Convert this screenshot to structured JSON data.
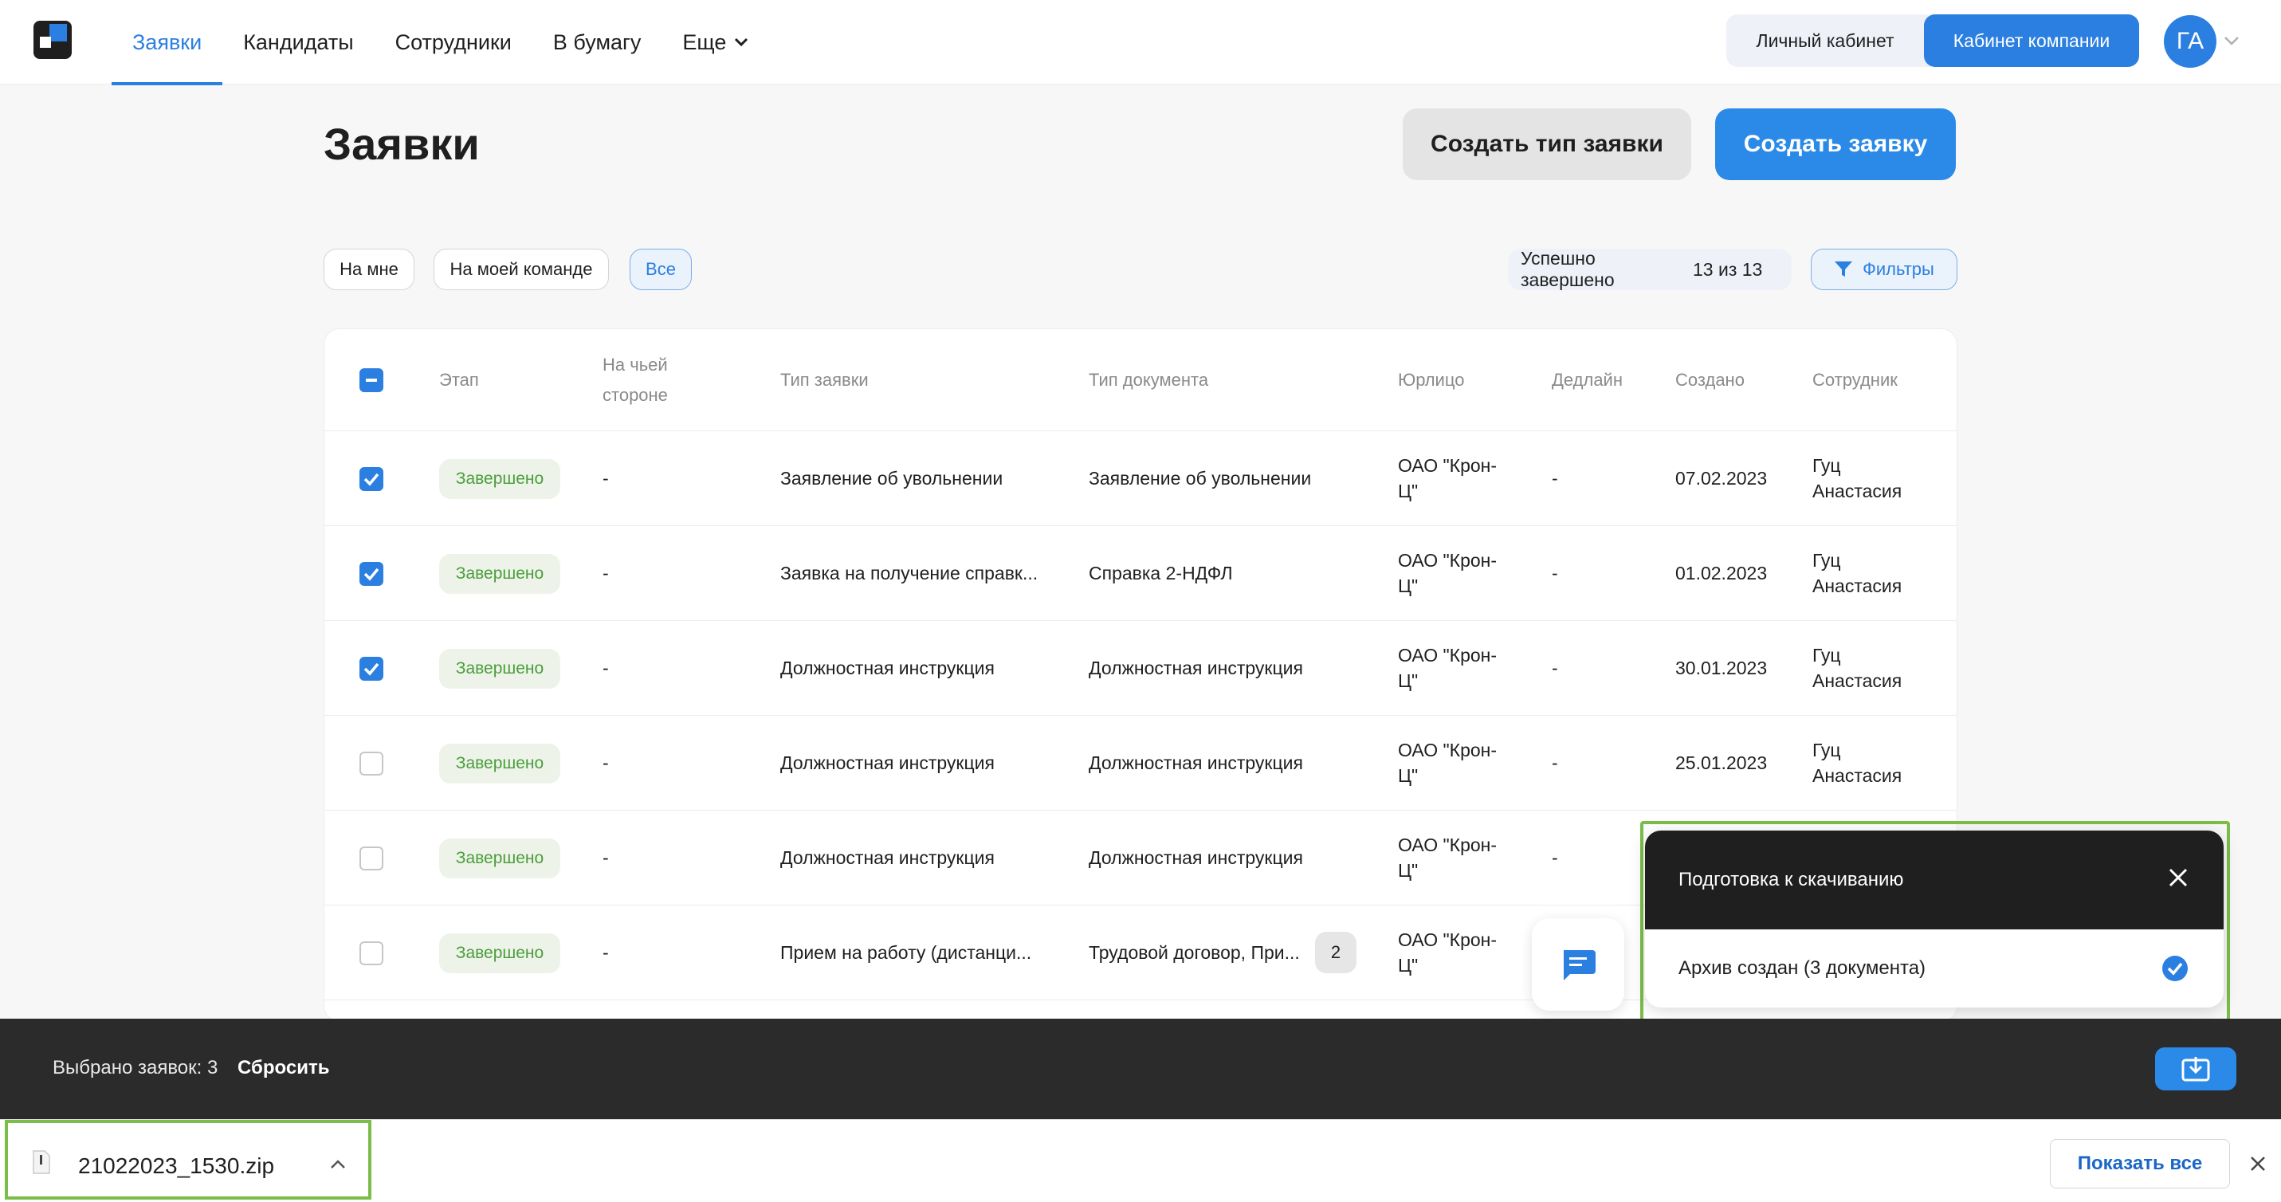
{
  "nav": {
    "items": [
      "Заявки",
      "Кандидаты",
      "Сотрудники",
      "В бумагу",
      "Еще"
    ],
    "active_index": 0,
    "cabinet_personal": "Личный кабинет",
    "cabinet_company": "Кабинет компании",
    "avatar_initials": "ГА"
  },
  "page": {
    "title": "Заявки",
    "create_type_button": "Создать тип заявки",
    "create_button": "Создать заявку"
  },
  "filters": {
    "chips": [
      "На мне",
      "На моей команде",
      "Все"
    ],
    "selected_chip": "Все",
    "status_label": "Успешно завершено",
    "status_count": "13 из 13",
    "filters_button": "Фильтры"
  },
  "table": {
    "columns": [
      "Этап",
      "На чьей стороне",
      "Тип заявки",
      "Тип документа",
      "Юрлицо",
      "Дедлайн",
      "Создано",
      "Сотрудник"
    ],
    "rows": [
      {
        "checked": true,
        "stage": "Завершено",
        "side": "-",
        "request_type": "Заявление об увольнении",
        "doc_type": "Заявление об увольнении",
        "doc_count": "",
        "entity": "ОАО \"Крон-Ц\"",
        "deadline": "-",
        "created": "07.02.2023",
        "employee": "Гуц Анастасия"
      },
      {
        "checked": true,
        "stage": "Завершено",
        "side": "-",
        "request_type": "Заявка на получение справк...",
        "doc_type": "Справка 2-НДФЛ",
        "doc_count": "",
        "entity": "ОАО \"Крон-Ц\"",
        "deadline": "-",
        "created": "01.02.2023",
        "employee": "Гуц Анастасия"
      },
      {
        "checked": true,
        "stage": "Завершено",
        "side": "-",
        "request_type": "Должностная инструкция",
        "doc_type": "Должностная инструкция",
        "doc_count": "",
        "entity": "ОАО \"Крон-Ц\"",
        "deadline": "-",
        "created": "30.01.2023",
        "employee": "Гуц Анастасия"
      },
      {
        "checked": false,
        "stage": "Завершено",
        "side": "-",
        "request_type": "Должностная инструкция",
        "doc_type": "Должностная инструкция",
        "doc_count": "",
        "entity": "ОАО \"Крон-Ц\"",
        "deadline": "-",
        "created": "25.01.2023",
        "employee": "Гуц Анастасия"
      },
      {
        "checked": false,
        "stage": "Завершено",
        "side": "-",
        "request_type": "Должностная инструкция",
        "doc_type": "Должностная инструкция",
        "doc_count": "",
        "entity": "ОАО \"Крон-Ц\"",
        "deadline": "-",
        "created": "",
        "employee": ""
      },
      {
        "checked": false,
        "stage": "Завершено",
        "side": "-",
        "request_type": "Прием на работу (дистанци...",
        "doc_type": "Трудовой договор, При...",
        "doc_count": "2",
        "entity": "ОАО \"Крон-Ц\"",
        "deadline": "",
        "created": "",
        "employee": ""
      }
    ]
  },
  "toast": {
    "title": "Подготовка к скачиванию",
    "message": "Архив создан (3 документа)"
  },
  "selection_bar": {
    "selected_text": "Выбрано заявок: 3",
    "reset_label": "Сбросить"
  },
  "downloads_shelf": {
    "file_name": "21022023_1530.zip",
    "show_all": "Показать все"
  },
  "colors": {
    "accent": "#2b7fe0",
    "success": "#4a9e3a",
    "highlight_outline": "#7cbd4a"
  }
}
